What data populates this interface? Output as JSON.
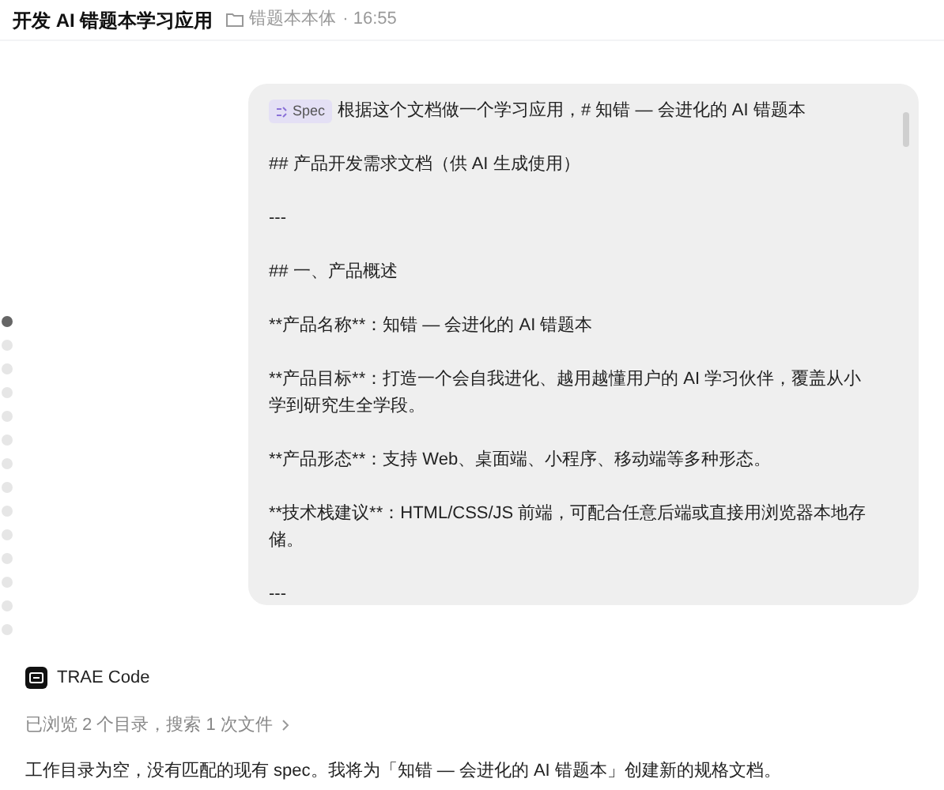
{
  "header": {
    "title": "开发 AI 错题本学习应用",
    "folder": "错题本本体",
    "time": "· 16:55"
  },
  "timeline": [
    {
      "selected": true
    },
    {
      "selected": false
    },
    {
      "selected": false
    },
    {
      "selected": false
    },
    {
      "selected": false
    },
    {
      "selected": false
    },
    {
      "selected": false
    },
    {
      "selected": false
    },
    {
      "selected": false
    },
    {
      "selected": false
    },
    {
      "selected": false
    },
    {
      "selected": false
    },
    {
      "selected": false
    },
    {
      "selected": false
    }
  ],
  "message": {
    "tag": "Spec",
    "lines": [
      "根据这个文档做一个学习应用，# 知错 — 会进化的 AI 错题本",
      "## 产品开发需求文档（供 AI 生成使用）",
      "---",
      "## 一、产品概述",
      "**产品名称**：知错 — 会进化的 AI 错题本",
      "**产品目标**：打造一个会自我进化、越用越懂用户的 AI 学习伙伴，覆盖从小学到研究生全学段。",
      "**产品形态**：支持 Web、桌面端、小程序、移动端等多种形态。",
      "**技术栈建议**：HTML/CSS/JS 前端，可配合任意后端或直接用浏览器本地存储。",
      "---"
    ]
  },
  "reply": {
    "agent": "TRAE Code",
    "activity": "已浏览 2 个目录，搜索 1 次文件",
    "text": "工作目录为空，没有匹配的现有 spec。我将为「知错 — 会进化的 AI 错题本」创建新的规格文档。"
  }
}
